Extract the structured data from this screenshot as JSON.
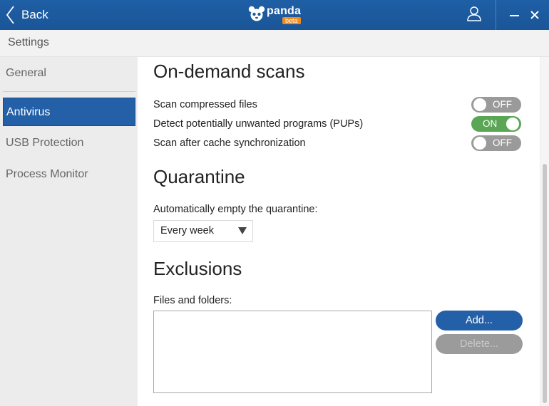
{
  "titlebar": {
    "back_label": "Back",
    "brand_name": "panda",
    "brand_badge": "beta",
    "minimize_label": "—",
    "close_label": "✕",
    "accent_color": "#1d5a9e"
  },
  "header": {
    "title": "Settings"
  },
  "sidebar": {
    "items": [
      {
        "label": "General",
        "active": false
      },
      {
        "label": "Antivirus",
        "active": true
      },
      {
        "label": "USB Protection",
        "active": false
      },
      {
        "label": "Process Monitor",
        "active": false
      }
    ],
    "active_color": "#2360a8"
  },
  "on_demand": {
    "title": "On-demand scans",
    "options": [
      {
        "label": "Scan compressed files",
        "state": "OFF"
      },
      {
        "label": "Detect potentially unwanted programs (PUPs)",
        "state": "ON"
      },
      {
        "label": "Scan after cache synchronization",
        "state": "OFF"
      }
    ],
    "on_color": "#5aa655",
    "off_color": "#9a9a9a"
  },
  "quarantine": {
    "title": "Quarantine",
    "empty_label": "Automatically empty the quarantine:",
    "empty_selected": "Every week"
  },
  "exclusions": {
    "title": "Exclusions",
    "files_label": "Files and folders:",
    "add_label": "Add...",
    "delete_label": "Delete..."
  }
}
